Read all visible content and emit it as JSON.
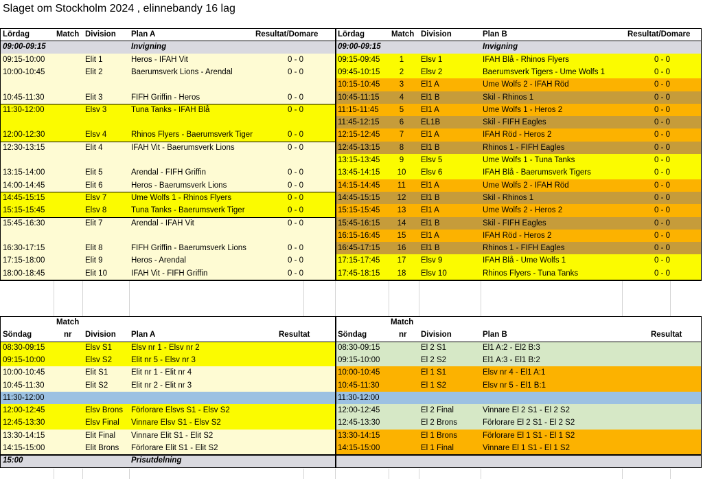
{
  "title": "Slaget om Stockholm 2024 , elinnebandy 16 lag",
  "colors": {
    "cream": "#fefbd3",
    "yellow": "#fbfb00",
    "orange": "#fcb200",
    "brown": "#c69c3a",
    "gray": "#d9d9df",
    "blue": "#9cc1e2",
    "green": "#d6e8c6"
  },
  "sat": {
    "header": {
      "a": {
        "day": "Lördag",
        "match": "Match",
        "division": "Division",
        "plan": "Plan A",
        "result": "Resultat/Domare"
      },
      "b": {
        "day": "Lördag",
        "match": "Match",
        "division": "Division",
        "plan": "Plan B",
        "result": "Resultat/Domare"
      }
    },
    "a_rows": [
      {
        "time": "09:00-09:15",
        "match": "",
        "div": "",
        "game": "Invigning",
        "res": "",
        "color": "gray",
        "italic": true
      },
      {
        "time": "09:15-10:00",
        "match": "",
        "div": "Elit 1",
        "game": "Heros - IFAH Vit",
        "res": "0 - 0",
        "color": "cream"
      },
      {
        "time": "10:00-10:45",
        "match": "",
        "div": "Elit 2",
        "game": "Baerumsverk Lions - Arendal",
        "res": "0 - 0",
        "color": "cream"
      },
      {
        "time": "",
        "match": "",
        "div": "",
        "game": "",
        "res": "",
        "color": "cream"
      },
      {
        "time": "10:45-11:30",
        "match": "",
        "div": "Elit 3",
        "game": "FIFH Griffin - Heros",
        "res": "0 - 0",
        "color": "cream"
      },
      {
        "time": "11:30-12:00",
        "match": "",
        "div": "Elsv 3",
        "game": "Tuna Tanks - IFAH Blå",
        "res": "0 - 0",
        "color": "yellow"
      },
      {
        "time": "",
        "match": "",
        "div": "",
        "game": "",
        "res": "",
        "color": "yellow"
      },
      {
        "time": "12:00-12:30",
        "match": "",
        "div": "Elsv 4",
        "game": "Rhinos Flyers - Baerumsverk Tiger",
        "res": "0 - 0",
        "color": "yellow"
      },
      {
        "time": "12:30-13:15",
        "match": "",
        "div": "Elit 4",
        "game": "IFAH Vit - Baerumsverk Lions",
        "res": "0 - 0",
        "color": "cream"
      },
      {
        "time": "",
        "match": "",
        "div": "",
        "game": "",
        "res": "",
        "color": "cream"
      },
      {
        "time": "13:15-14:00",
        "match": "",
        "div": "Elit 5",
        "game": "Arendal - FIFH Griffin",
        "res": "0 - 0",
        "color": "cream"
      },
      {
        "time": "14:00-14:45",
        "match": "",
        "div": "Elit 6",
        "game": "Heros - Baerumsverk Lions",
        "res": "0 - 0",
        "color": "cream"
      },
      {
        "time": "14:45-15:15",
        "match": "",
        "div": "Elsv 7",
        "game": "Ume Wolfs 1 - Rhinos Flyers",
        "res": "0 - 0",
        "color": "yellow"
      },
      {
        "time": "15:15-15:45",
        "match": "",
        "div": "Elsv 8",
        "game": "Tuna Tanks - Baerumsverk Tiger",
        "res": "0 - 0",
        "color": "yellow"
      },
      {
        "time": "15:45-16:30",
        "match": "",
        "div": "Elit 7",
        "game": "Arendal - IFAH Vit",
        "res": "0 - 0",
        "color": "cream"
      },
      {
        "time": "",
        "match": "",
        "div": "",
        "game": "",
        "res": "",
        "color": "cream"
      },
      {
        "time": "16:30-17:15",
        "match": "",
        "div": "Elit 8",
        "game": "FIFH Griffin - Baerumsverk Lions",
        "res": "0 - 0",
        "color": "cream"
      },
      {
        "time": "17:15-18:00",
        "match": "",
        "div": "Elit 9",
        "game": "Heros - Arendal",
        "res": "0 - 0",
        "color": "cream"
      },
      {
        "time": "18:00-18:45",
        "match": "",
        "div": "Elit 10",
        "game": "IFAH Vit - FIFH Griffin",
        "res": "0 - 0",
        "color": "cream"
      }
    ],
    "b_rows": [
      {
        "time": "09:00-09:15",
        "match": "",
        "div": "",
        "game": "Invigning",
        "res": "",
        "color": "gray",
        "italic": true
      },
      {
        "time": "09:15-09:45",
        "match": "1",
        "div": "Elsv 1",
        "game": "IFAH Blå - Rhinos Flyers",
        "res": "0 - 0",
        "color": "yellow"
      },
      {
        "time": "09:45-10:15",
        "match": "2",
        "div": "Elsv 2",
        "game": "Baerumsverk Tigers - Ume Wolfs 1",
        "res": "0 - 0",
        "color": "yellow"
      },
      {
        "time": "10:15-10:45",
        "match": "3",
        "div": "El1 A",
        "game": "Ume Wolfs 2 - IFAH Röd",
        "res": "0 - 0",
        "color": "orange"
      },
      {
        "time": "10:45-11:15",
        "match": "4",
        "div": "El1 B",
        "game": "Skil - Rhinos 1",
        "res": "0 - 0",
        "color": "brown"
      },
      {
        "time": "11:15-11:45",
        "match": "5",
        "div": "El1 A",
        "game": "Ume Wolfs 1 - Heros 2",
        "res": "0 - 0",
        "color": "orange"
      },
      {
        "time": "11:45-12:15",
        "match": "6",
        "div": "EL1B",
        "game": "Skil - FIFH Eagles",
        "res": "0 - 0",
        "color": "brown"
      },
      {
        "time": "12:15-12:45",
        "match": "7",
        "div": "El1 A",
        "game": "IFAH Röd - Heros 2",
        "res": "0 - 0",
        "color": "orange"
      },
      {
        "time": "12:45-13:15",
        "match": "8",
        "div": "El1 B",
        "game": "Rhinos 1 - FIFH Eagles",
        "res": "0 - 0",
        "color": "brown"
      },
      {
        "time": "13:15-13:45",
        "match": "9",
        "div": "Elsv 5",
        "game": "Ume Wolfs 1 - Tuna Tanks",
        "res": "0 - 0",
        "color": "yellow"
      },
      {
        "time": "13:45-14:15",
        "match": "10",
        "div": "Elsv 6",
        "game": "IFAH Blå - Baerumsverk Tigers",
        "res": "0 - 0",
        "color": "yellow"
      },
      {
        "time": "14:15-14:45",
        "match": "11",
        "div": "El1 A",
        "game": "Ume Wolfs 2 - IFAH Röd",
        "res": "0 - 0",
        "color": "orange"
      },
      {
        "time": "14:45-15:15",
        "match": "12",
        "div": "El1 B",
        "game": "Skil - Rhinos 1",
        "res": "0 - 0",
        "color": "brown"
      },
      {
        "time": "15:15-15:45",
        "match": "13",
        "div": "El1 A",
        "game": "Ume Wolfs 2 - Heros 2",
        "res": "0 - 0",
        "color": "orange"
      },
      {
        "time": "15:45-16:15",
        "match": "14",
        "div": "El1 B",
        "game": "Skil - FIFH Eagles",
        "res": "0 - 0",
        "color": "brown"
      },
      {
        "time": "16:15-16:45",
        "match": "15",
        "div": "El1 A",
        "game": "IFAH Röd - Heros 2",
        "res": "0 - 0",
        "color": "orange"
      },
      {
        "time": "16:45-17:15",
        "match": "16",
        "div": "El1 B",
        "game": "Rhinos 1 - FIFH Eagles",
        "res": "0 - 0",
        "color": "brown"
      },
      {
        "time": "17:15-17:45",
        "match": "17",
        "div": "Elsv 9",
        "game": "IFAH Blå - Ume Wolfs 1",
        "res": "0 - 0",
        "color": "yellow"
      },
      {
        "time": "17:45-18:15",
        "match": "18",
        "div": "Elsv 10",
        "game": "Rhinos Flyers - Tuna Tanks",
        "res": "0 - 0",
        "color": "yellow"
      }
    ]
  },
  "sun": {
    "header": {
      "a": {
        "match_top": "Match",
        "day": "Söndag",
        "nr": "nr",
        "division": "Division",
        "plan": "Plan A",
        "result": "Resultat"
      },
      "b": {
        "match_top": "Match",
        "day": "Söndag",
        "nr": "nr",
        "division": "Division",
        "plan": "Plan B",
        "result": "Resultat"
      }
    },
    "a_rows": [
      {
        "time": "08:30-09:15",
        "div": "Elsv S1",
        "game": "Elsv nr 1  - Elsv nr 2",
        "color": "yellow"
      },
      {
        "time": "09:15-10:00",
        "div": "Elsv S2",
        "game": "Elit nr 5 - Elsv nr 3",
        "color": "yellow"
      },
      {
        "time": "10:00-10:45",
        "div": "Elit S1",
        "game": "Elit nr 1 - Elit nr 4",
        "color": "cream"
      },
      {
        "time": "10:45-11:30",
        "div": "Elit S2",
        "game": "Elit nr 2 - Elit nr 3",
        "color": "cream"
      },
      {
        "time": "11:30-12:00",
        "div": "",
        "game": "",
        "color": "blue"
      },
      {
        "time": "12:00-12:45",
        "div": "Elsv Brons",
        "game": "Förlorare Elsvs S1 - Elsv S2",
        "color": "yellow"
      },
      {
        "time": "12:45-13:30",
        "div": "Elsv Final",
        "game": "Vinnare Elsv S1 - Elsv S2",
        "color": "yellow"
      },
      {
        "time": "13:30-14:15",
        "div": "Elit Final",
        "game": "Vinnare Elit S1 - Elit S2",
        "color": "cream"
      },
      {
        "time": "14:15-15:00",
        "div": "Elit Brons",
        "game": "Förlorare Elit S1 - Elit S2",
        "color": "cream"
      }
    ],
    "b_rows": [
      {
        "time": "08:30-09:15",
        "div": "El 2 S1",
        "game": "El1 A:2 - El2 B:3",
        "color": "green"
      },
      {
        "time": "09:15-10:00",
        "div": "El 2 S2",
        "game": "El1 A:3 - El1 B:2",
        "color": "green"
      },
      {
        "time": "10:00-10:45",
        "div": "El 1 S1",
        "game": "Elsv nr 4 - El1 A:1",
        "color": "orange"
      },
      {
        "time": "10:45-11:30",
        "div": "El 1 S2",
        "game": "Elsv nr 5 - El1 B:1",
        "color": "orange"
      },
      {
        "time": "11:30-12:00",
        "div": "",
        "game": "",
        "color": "blue"
      },
      {
        "time": "12:00-12:45",
        "div": "El 2 Final",
        "game": "Vinnare El 2 S1 - El 2 S2",
        "color": "green"
      },
      {
        "time": "12:45-13:30",
        "div": "El 2 Brons",
        "game": "Förlorare El 2 S1 - El 2 S2",
        "color": "green"
      },
      {
        "time": "13:30-14:15",
        "div": "El 1 Brons",
        "game": "Förlorare El 1 S1 - El 1 S2",
        "color": "orange"
      },
      {
        "time": "14:15-15:00",
        "div": "El 1 Final",
        "game": "Vinnare El  1 S1 - El 1 S2",
        "color": "orange"
      }
    ],
    "footer": {
      "time": "15:00",
      "label": "Prisutdelning"
    }
  }
}
